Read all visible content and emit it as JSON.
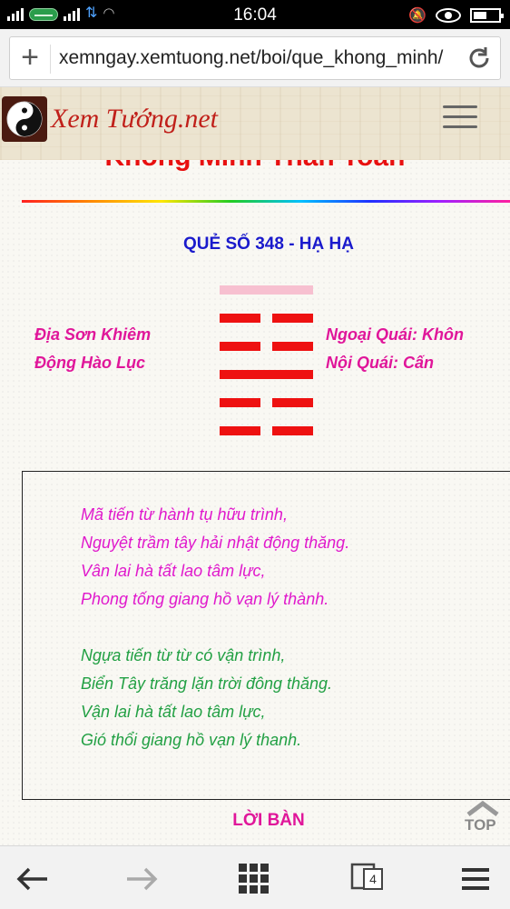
{
  "status_bar": {
    "time": "16:04",
    "colors": {
      "background": "#000000",
      "network": "#4fa3ff"
    }
  },
  "browser": {
    "url": "xemngay.xemtuong.net/boi/que_khong_minh/",
    "tab_count": "4",
    "icons": [
      "plus-icon",
      "reload-icon",
      "back-arrow-icon",
      "forward-arrow-icon",
      "grid-icon",
      "tabs-icon",
      "menu-icon"
    ]
  },
  "site": {
    "logo_text": "Xem Tướng.net",
    "menu_icon": "hamburger-icon"
  },
  "page": {
    "heading": "Khổng Minh Thần Toán",
    "que_title": "QUẺ SỐ 348 - HẠ HẠ",
    "left_labels": [
      "Địa Sơn Khiêm",
      "Động Hào Lục"
    ],
    "right_labels": [
      "Ngoại Quái: Khôn",
      "Nội Quái: Cấn"
    ],
    "hexagram_lines": [
      {
        "type": "yang",
        "changing": true,
        "color": "#f7c0d0"
      },
      {
        "type": "yin",
        "changing": false,
        "color": "#ee1111"
      },
      {
        "type": "yin",
        "changing": false,
        "color": "#ee1111"
      },
      {
        "type": "yang",
        "changing": false,
        "color": "#ee1111"
      },
      {
        "type": "yin",
        "changing": false,
        "color": "#ee1111"
      },
      {
        "type": "yin",
        "changing": false,
        "color": "#ee1111"
      }
    ],
    "poem_sino": [
      "Mã tiến từ hành tụ hữu trình,",
      "Nguyệt trầm tây hải nhật động thăng.",
      "Vân lai hà tất lao tâm lực,",
      "Phong tống giang hồ vạn lý thành."
    ],
    "poem_viet": [
      "Ngựa tiến từ từ có vận trình,",
      "Biển Tây trăng lặn trời đông thăng.",
      "Vận lai hà tất lao tâm lực,",
      "Gió thổi giang hồ vạn lý thanh."
    ],
    "section_label": "LỜI BÀN",
    "top_button": "TOP",
    "colors": {
      "heading": "#e81010",
      "title": "#1a1acc",
      "labels": "#e0169a",
      "poem_sino": "#e019cc",
      "poem_viet": "#22a044"
    }
  }
}
